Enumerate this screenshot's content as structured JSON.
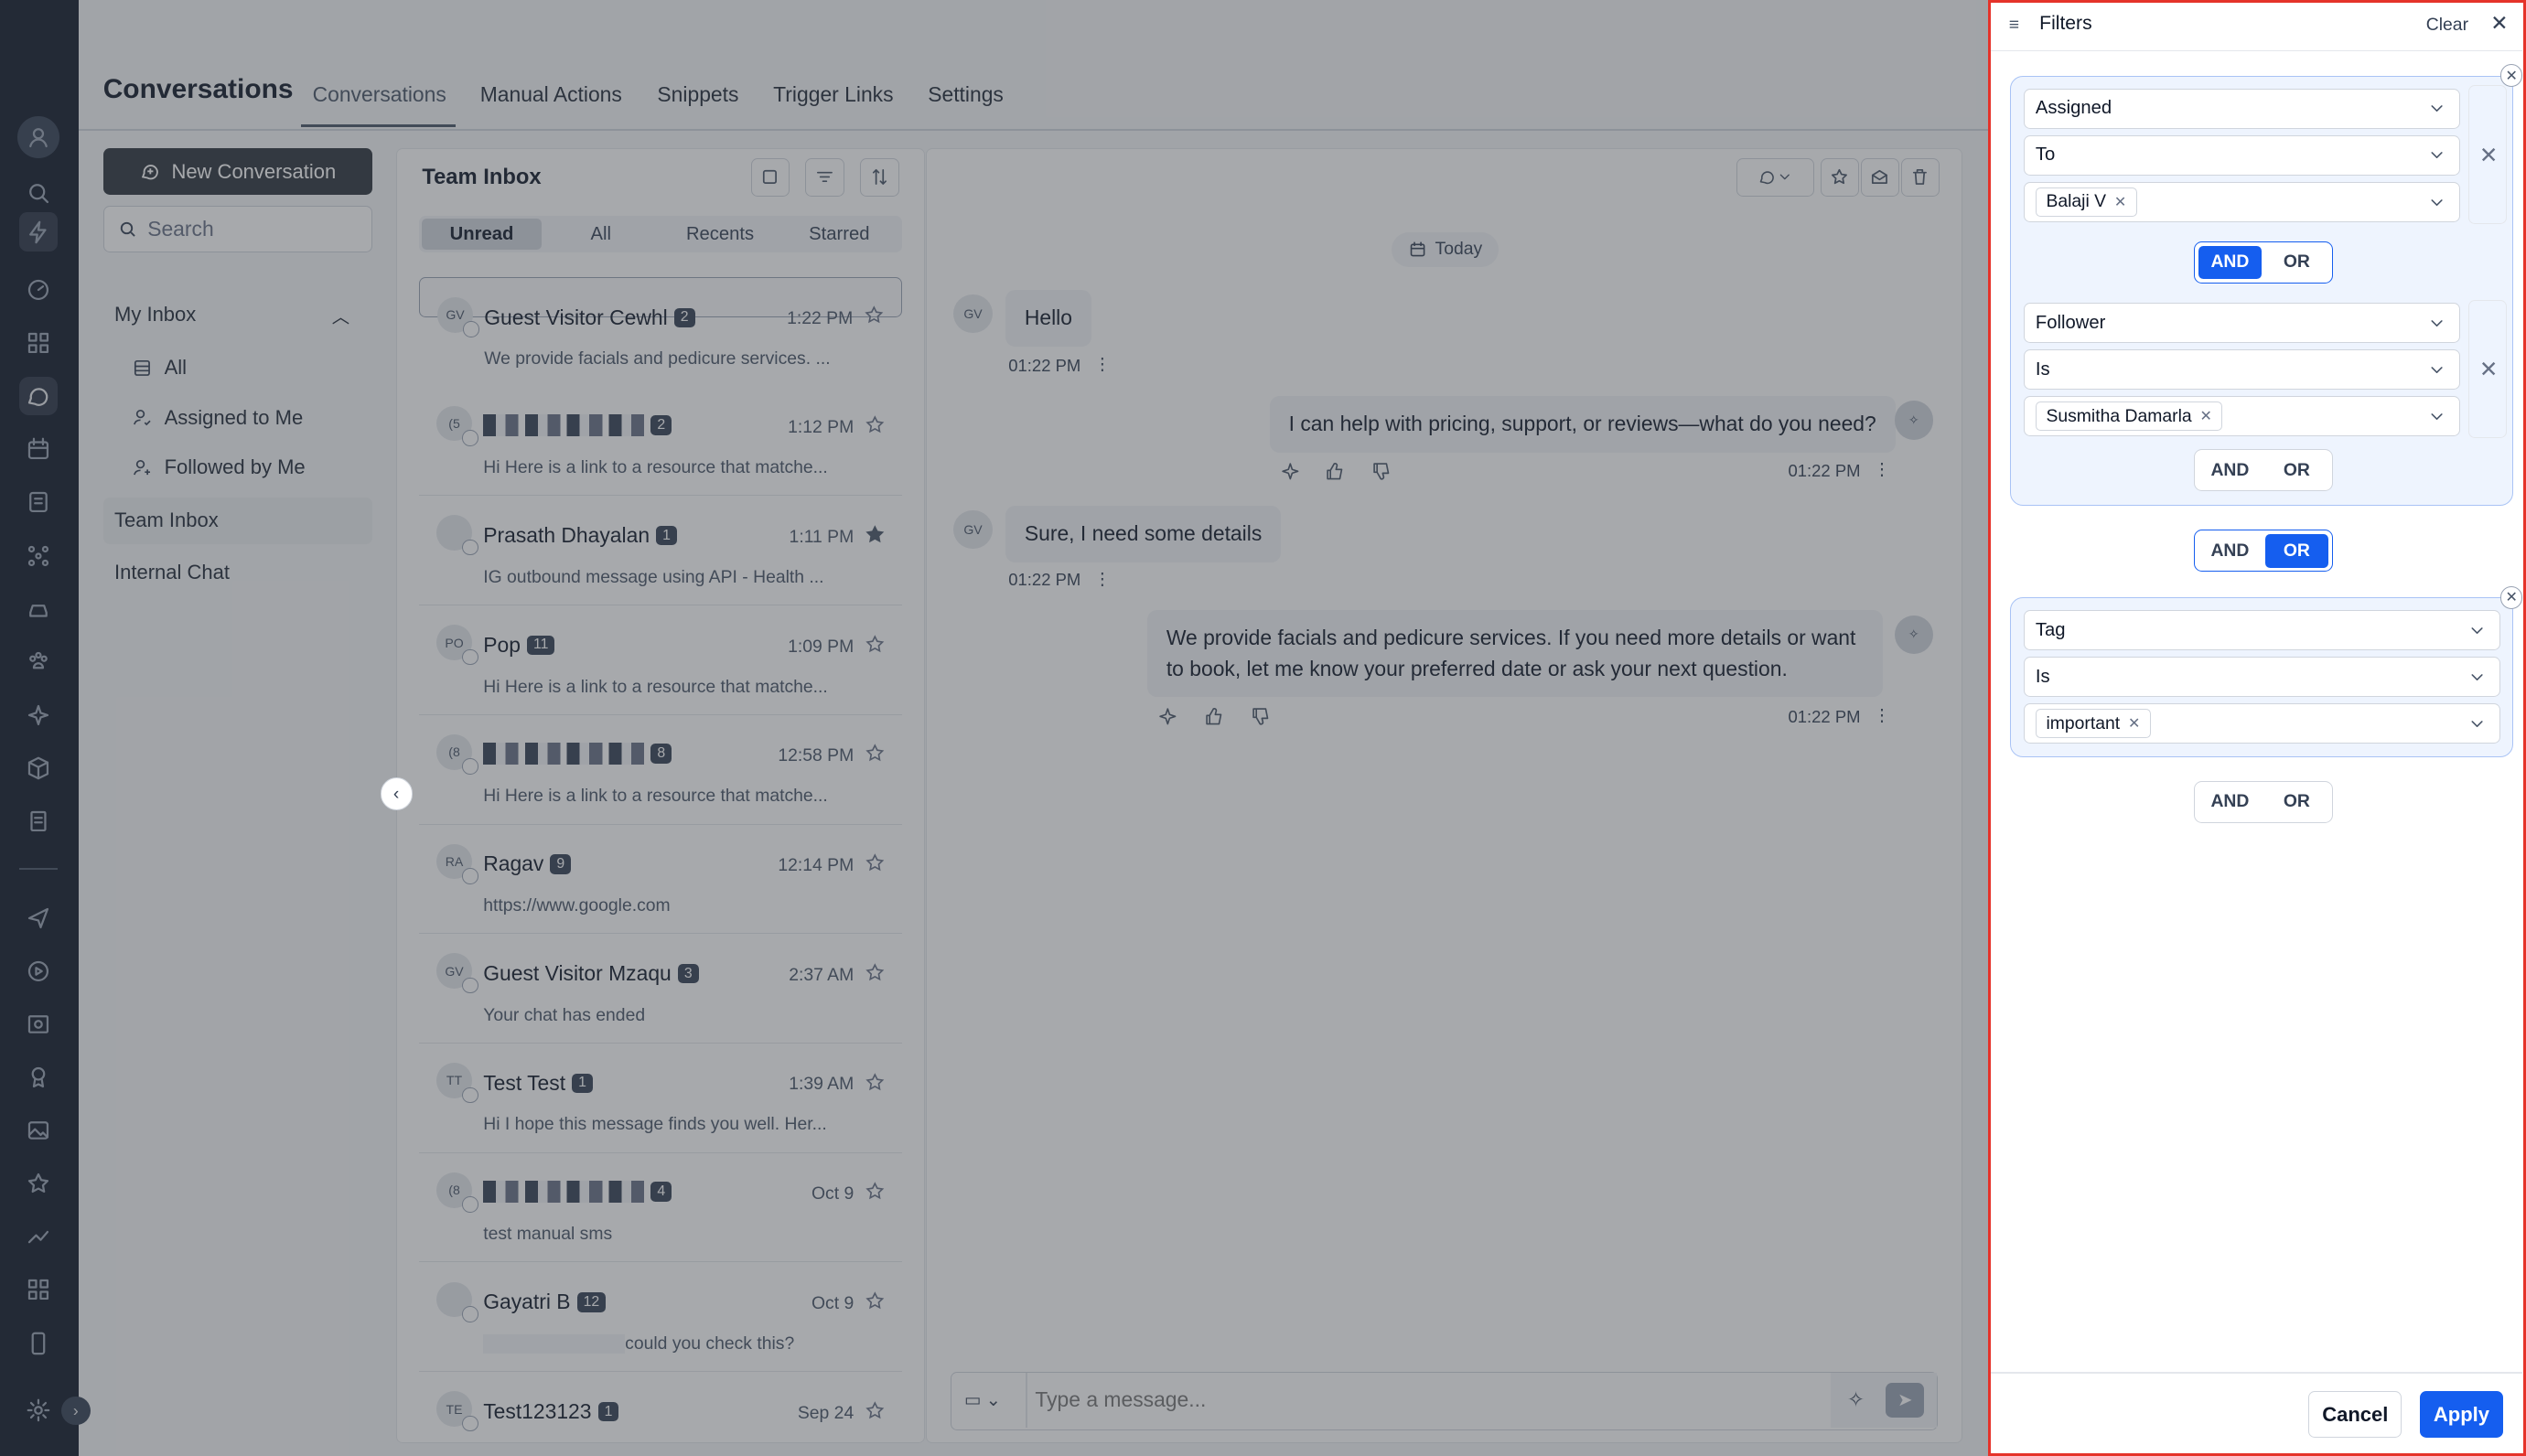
{
  "app": {
    "title": "Conversations"
  },
  "tabs": [
    "Conversations",
    "Manual Actions",
    "Snippets",
    "Trigger Links",
    "Settings"
  ],
  "sidebar": {
    "new_conversation": "New Conversation",
    "search_placeholder": "Search",
    "my_inbox": "My Inbox",
    "items": [
      "All",
      "Assigned to Me",
      "Followed by Me"
    ],
    "team_inbox": "Team Inbox",
    "internal_chat": "Internal Chat"
  },
  "list": {
    "title": "Team Inbox",
    "segments": [
      "Unread",
      "All",
      "Recents",
      "Starred"
    ],
    "active_segment": "Unread",
    "conversations": [
      {
        "initials": "GV",
        "name": "Guest Visitor Cewhl",
        "count": "2",
        "time": "1:22 PM",
        "preview": "We provide facials and pedicure services. ...",
        "starred": false,
        "redacted": false
      },
      {
        "initials": "(5",
        "name": "",
        "count": "2",
        "time": "1:12 PM",
        "preview": "Hi Here is a link to a resource that matche...",
        "starred": false,
        "redacted": true
      },
      {
        "initials": "",
        "name": "Prasath Dhayalan",
        "count": "1",
        "time": "1:11 PM",
        "preview": "IG outbound message using API - Health ...",
        "starred": true,
        "redacted": false
      },
      {
        "initials": "PO",
        "name": "Pop",
        "count": "11",
        "time": "1:09 PM",
        "preview": "Hi Here is a link to a resource that matche...",
        "starred": false,
        "redacted": false
      },
      {
        "initials": "(8",
        "name": "",
        "count": "8",
        "time": "12:58 PM",
        "preview": "Hi Here is a link to a resource that matche...",
        "starred": false,
        "redacted": true
      },
      {
        "initials": "RA",
        "name": "Ragav",
        "count": "9",
        "time": "12:14 PM",
        "preview": "https://www.google.com",
        "starred": false,
        "redacted": false
      },
      {
        "initials": "GV",
        "name": "Guest Visitor Mzaqu",
        "count": "3",
        "time": "2:37 AM",
        "preview": "Your chat has ended",
        "starred": false,
        "redacted": false
      },
      {
        "initials": "TT",
        "name": "Test Test",
        "count": "1",
        "time": "1:39 AM",
        "preview": "Hi I hope this message finds you well. Her...",
        "starred": false,
        "redacted": false
      },
      {
        "initials": "(8",
        "name": "",
        "count": "4",
        "time": "Oct 9",
        "preview": "test manual sms",
        "starred": false,
        "redacted": true
      },
      {
        "initials": "",
        "name": "Gayatri B",
        "count": "12",
        "time": "Oct 9",
        "preview": "could you check this?",
        "starred": false,
        "redacted": false
      },
      {
        "initials": "TE",
        "name": "Test123123",
        "count": "1",
        "time": "Sep 24",
        "preview": "",
        "starred": false,
        "redacted": false
      }
    ]
  },
  "chat": {
    "date_label": "Today",
    "messages": [
      {
        "dir": "in",
        "initials": "GV",
        "text": "Hello",
        "time": "01:22 PM"
      },
      {
        "dir": "out",
        "text": "I can help with pricing, support, or reviews—what do you need?",
        "time": "01:22 PM"
      },
      {
        "dir": "in",
        "initials": "GV",
        "text": "Sure, I need some details",
        "time": "01:22 PM"
      },
      {
        "dir": "out",
        "text": "We provide facials and pedicure services. If you need more details or want to book, let me know your preferred date or ask your next question.",
        "time": "01:22 PM"
      }
    ],
    "composer_placeholder": "Type a message..."
  },
  "filters": {
    "title": "Filters",
    "clear": "Clear",
    "groups": [
      {
        "conditions": [
          {
            "field": "Assigned",
            "operator": "To",
            "values": [
              "Balaji V"
            ]
          },
          {
            "field": "Follower",
            "operator": "Is",
            "values": [
              "Susmitha Damarla"
            ]
          }
        ],
        "inner_connector": "AND"
      },
      {
        "conditions": [
          {
            "field": "Tag",
            "operator": "Is",
            "values": [
              "important"
            ]
          }
        ]
      }
    ],
    "group_connector": "OR",
    "and_label": "AND",
    "or_label": "OR",
    "cancel": "Cancel",
    "apply": "Apply"
  },
  "colors": {
    "accent": "#155eef",
    "highlight_border": "#e5332a",
    "rail": "#101828"
  }
}
